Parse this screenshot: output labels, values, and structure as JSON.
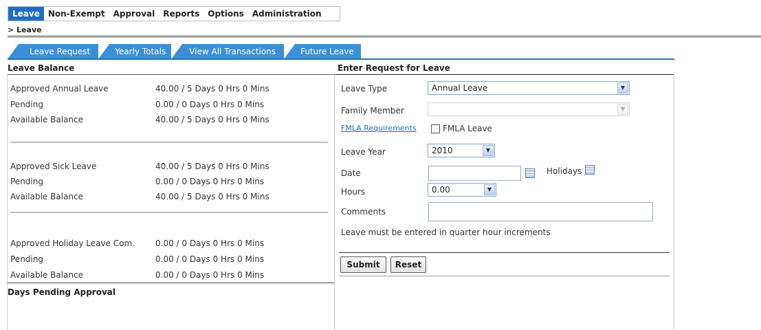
{
  "menu": [
    "Leave",
    "Non-Exempt",
    "Approval",
    "Reports",
    "Options",
    "Administration"
  ],
  "breadcrumb": "> Leave",
  "tabs": [
    "Leave Request",
    "Yearly Totals",
    "View All Transactions",
    "Future Leave"
  ],
  "balance": {
    "title": "Leave Balance",
    "groups": [
      {
        "rows": [
          {
            "label": "Approved Annual Leave",
            "value": "40.00 / 5 Days 0 Hrs 0 Mins"
          },
          {
            "label": "Pending",
            "value": "0.00 / 0 Days 0 Hrs 0 Mins"
          },
          {
            "label": "Available Balance",
            "value": "40.00 / 5 Days 0 Hrs 0 Mins"
          }
        ]
      },
      {
        "rows": [
          {
            "label": "Approved Sick Leave",
            "value": "40.00 / 5 Days 0 Hrs 0 Mins"
          },
          {
            "label": "Pending",
            "value": "0.00 / 0 Days 0 Hrs 0 Mins"
          },
          {
            "label": "Available Balance",
            "value": "40.00 / 5 Days 0 Hrs 0 Mins"
          }
        ]
      },
      {
        "rows": [
          {
            "label": "Approved Holiday Leave Com.",
            "value": "0.00 / 0 Days 0 Hrs 0 Mins"
          },
          {
            "label": "Pending",
            "value": "0.00 / 0 Days 0 Hrs 0 Mins"
          },
          {
            "label": "Available Balance",
            "value": "0.00 / 0 Days 0 Hrs 0 Mins"
          }
        ]
      }
    ],
    "pending_title": "Days Pending Approval"
  },
  "form": {
    "title": "Enter Request for Leave",
    "leave_type_label": "Leave Type",
    "leave_type_value": "Annual Leave",
    "family_member_label": "Family Member",
    "family_member_value": "",
    "fmla_link": "FMLA Requirements",
    "fmla_checkbox_label": "FMLA Leave",
    "leave_year_label": "Leave Year",
    "leave_year_value": "2010",
    "date_label": "Date",
    "date_value": "",
    "holidays_label": "Holidays",
    "hours_label": "Hours",
    "hours_value": "0.00",
    "comments_label": "Comments",
    "comments_value": "",
    "note": "Leave must be entered in quarter hour increments",
    "submit_label": "Submit",
    "reset_label": "Reset"
  },
  "colors": {
    "accent": "#1f6fc4",
    "tab": "#3c8fd6"
  },
  "icons": {
    "dropdown": "chevron-down-icon",
    "calendar": "calendar-icon"
  }
}
